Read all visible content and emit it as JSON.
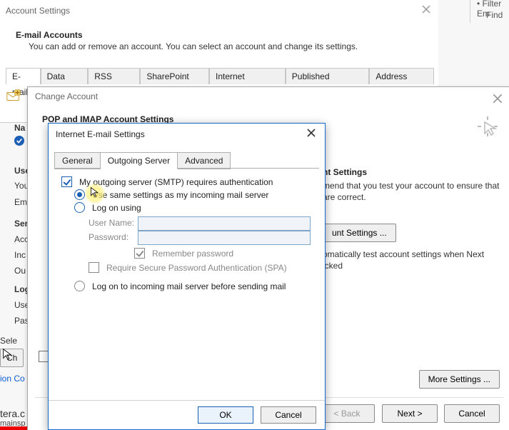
{
  "outer": {
    "filter": "Filter Em",
    "find": "Find"
  },
  "account_settings": {
    "title": "Account Settings",
    "h1": "E-mail Accounts",
    "desc": "You can add or remove an account. You can select an account and change its settings.",
    "tabs": [
      "E-mail",
      "Data Files",
      "RSS Feeds",
      "SharePoint Lists",
      "Internet Calendars",
      "Published Calendars",
      "Address Books"
    ],
    "column_name": "Na",
    "partial": {
      "use": "Use",
      "you": "You",
      "ema": "Ema",
      "ser": "Ser",
      "acc": "Acc",
      "inc": "Inc",
      "out": "Ou",
      "log": "Log",
      "use2": "Use",
      "pas": "Pas",
      "sele": "Sele",
      "ch_btn": "Ch"
    }
  },
  "change_account": {
    "title": "Change Account",
    "h1": "POP and IMAP Account Settings",
    "test_h": "nt Settings",
    "test_desc": "mend that you test your account to ensure that are correct.",
    "test_btn": "unt Settings ...",
    "auto_txt": "omatically test account settings when Next icked",
    "more_btn": "More Settings ...",
    "back_btn": "< Back",
    "next_btn": "Next >",
    "cancel_btn": "Cancel"
  },
  "ie": {
    "title": "Internet E-mail Settings",
    "tabs": {
      "general": "General",
      "outgoing": "Outgoing Server",
      "advanced": "Advanced"
    },
    "chk_auth": "My outgoing server (SMTP) requires authentication",
    "rad_same": "Use same settings as my incoming mail server",
    "rad_logon": "Log on using",
    "lbl_user": "User Name:",
    "lbl_pass": "Password:",
    "chk_remember": "Remember password",
    "chk_spa": "Require Secure Password Authentication (SPA)",
    "rad_send": "Log on to incoming mail server before sending mail",
    "ok": "OK",
    "cancel": "Cancel"
  },
  "fragments": {
    "link_co": "ion Co",
    "tera": "tera.c",
    "mainsp": "mainsp"
  }
}
